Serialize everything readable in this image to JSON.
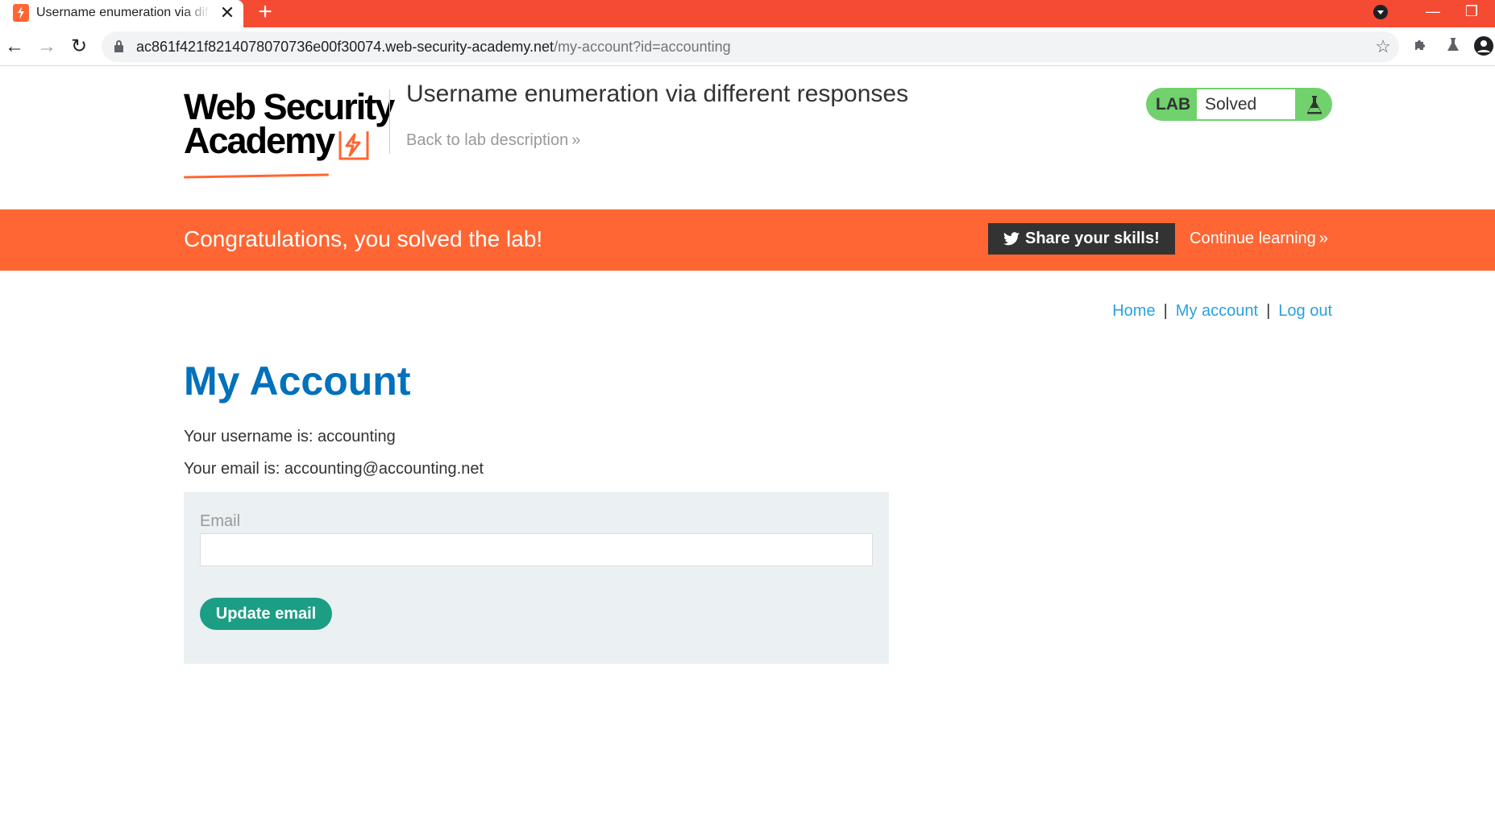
{
  "browser": {
    "tab_title": "Username enumeration via different responses",
    "tab_close": "✕",
    "new_tab": "+",
    "url_host": "ac861f421f8214078070736e00f30074.web-security-academy.net",
    "url_path": "/my-account?id=accounting",
    "back_icon": "arrow-left-icon",
    "forward_icon": "arrow-right-icon",
    "reload_icon": "reload-icon",
    "accent": "#f44b32"
  },
  "header": {
    "logo_line1": "Web Security",
    "logo_line2": "Academy",
    "lab_title": "Username enumeration via different responses",
    "back_link": "Back to lab description",
    "badge_lab": "LAB",
    "badge_status": "Solved",
    "badge_color": "#70d16d"
  },
  "banner": {
    "message": "Congratulations, you solved the lab!",
    "share_label": "Share your skills!",
    "continue_label": "Continue learning",
    "color": "#ff6633"
  },
  "nav": {
    "home": "Home",
    "my_account": "My account",
    "log_out": "Log out",
    "separator": "|"
  },
  "main": {
    "heading": "My Account",
    "username_line": "Your username is: accounting",
    "email_line": "Your email is: accounting@accounting.net",
    "form": {
      "email_label": "Email",
      "email_value": "",
      "submit_label": "Update email"
    }
  }
}
